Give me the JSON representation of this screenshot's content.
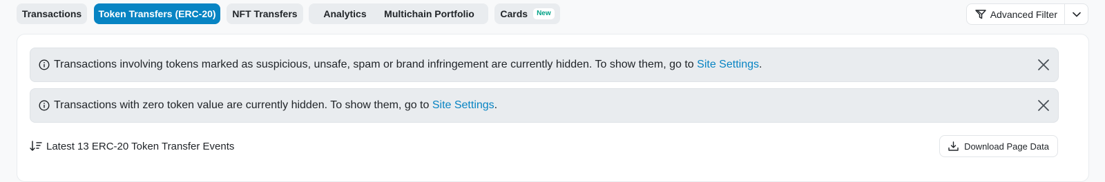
{
  "tabs": [
    {
      "label": "Transactions",
      "active": false
    },
    {
      "label": "Token Transfers (ERC-20)",
      "active": true
    },
    {
      "label": "NFT Transfers",
      "active": false
    },
    {
      "label": "Analytics",
      "active": false
    },
    {
      "label": "Multichain Portfolio",
      "active": false
    },
    {
      "label": "Cards",
      "active": false,
      "badge": "New"
    }
  ],
  "filter": {
    "label": "Advanced Filter",
    "icon": "filter-icon",
    "caret_icon": "chevron-down-icon"
  },
  "alerts": [
    {
      "text": "Transactions involving tokens marked as suspicious, unsafe, spam or brand infringement are currently hidden. To show them, go to ",
      "link": "Site Settings",
      "suffix": "."
    },
    {
      "text": "Transactions with zero token value are currently hidden. To show them, go to ",
      "link": "Site Settings",
      "suffix": "."
    }
  ],
  "summary": {
    "text": "Latest 13 ERC-20 Token Transfer Events",
    "icon": "sort-descending-icon"
  },
  "download": {
    "label": "Download Page Data",
    "icon": "download-icon"
  },
  "colors": {
    "accent": "#0784c3",
    "badge": "#00a186",
    "tab_bg": "#e9ecef"
  }
}
